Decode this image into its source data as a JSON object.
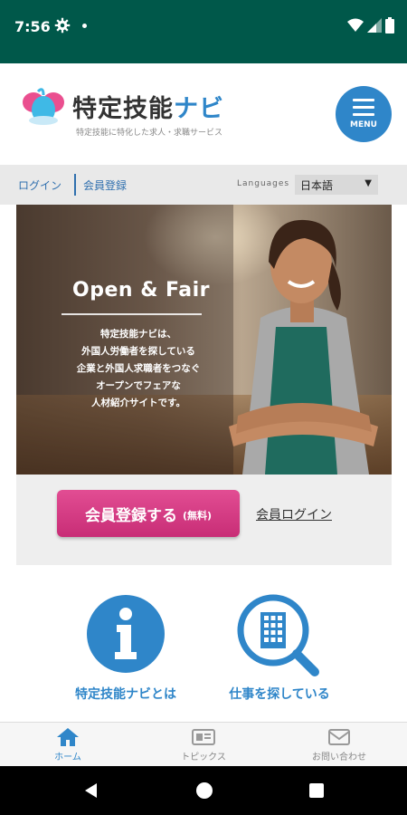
{
  "status_bar": {
    "time": "7:56"
  },
  "header": {
    "logo_title_main": "特定技能",
    "logo_title_accent": "ナビ",
    "logo_subtitle": "特定技能に特化した求人・求職サービス",
    "menu_label": "MENU"
  },
  "link_bar": {
    "login": "ログイン",
    "register": "会員登録",
    "languages_label": "Languages",
    "language_selected": "日本語"
  },
  "hero": {
    "title": "Open & Fair",
    "lines": [
      "特定技能ナビは、",
      "外国人労働者を探している",
      "企業と外国人求職者をつなぐ",
      "オープンでフェアな",
      "人材紹介サイトです。"
    ]
  },
  "cta": {
    "register_button": "会員登録する",
    "register_note": "(無料)",
    "member_login": "会員ログイン"
  },
  "features": [
    {
      "label": "特定技能ナビとは",
      "icon": "info-icon"
    },
    {
      "label": "仕事を探している",
      "icon": "building-search-icon"
    }
  ],
  "bottom_nav": [
    {
      "label": "ホーム",
      "icon": "home-icon",
      "active": true
    },
    {
      "label": "トピックス",
      "icon": "news-icon",
      "active": false
    },
    {
      "label": "お問い合わせ",
      "icon": "mail-icon",
      "active": false
    }
  ],
  "colors": {
    "status_bar": "#00584a",
    "brand_blue": "#2f86c9",
    "cta_pink": "#d63a84"
  }
}
